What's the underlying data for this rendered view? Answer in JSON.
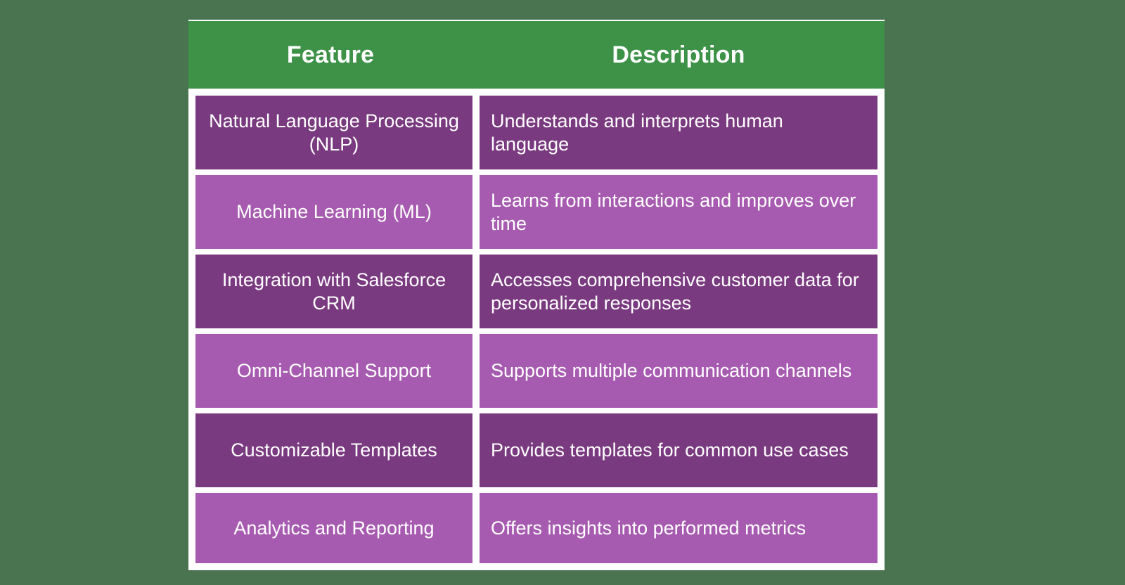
{
  "palette": {
    "page_background": "#4a7450",
    "card_background": "#ffffff",
    "header_green": "#3d9248",
    "row_dark_purple": "#7a3a80",
    "row_light_purple": "#a75bb0",
    "text_on_fill": "#ffffff"
  },
  "table": {
    "columns": [
      {
        "key": "feature",
        "label": "Feature"
      },
      {
        "key": "description",
        "label": "Description"
      }
    ],
    "rows": [
      {
        "feature": "Natural Language Processing (NLP)",
        "description": "Understands and interprets human language",
        "tone": "dark"
      },
      {
        "feature": "Machine Learning (ML)",
        "description": "Learns from interactions and improves over time",
        "tone": "light"
      },
      {
        "feature": "Integration with Salesforce CRM",
        "description": "Accesses comprehensive customer data for personalized responses",
        "tone": "dark"
      },
      {
        "feature": "Omni-Channel Support",
        "description": "Supports multiple communication channels",
        "tone": "light"
      },
      {
        "feature": "Customizable Templates",
        "description": "Provides templates for common use cases",
        "tone": "dark"
      },
      {
        "feature": "Analytics and Reporting",
        "description": "Offers insights into performed metrics",
        "tone": "light"
      }
    ]
  }
}
